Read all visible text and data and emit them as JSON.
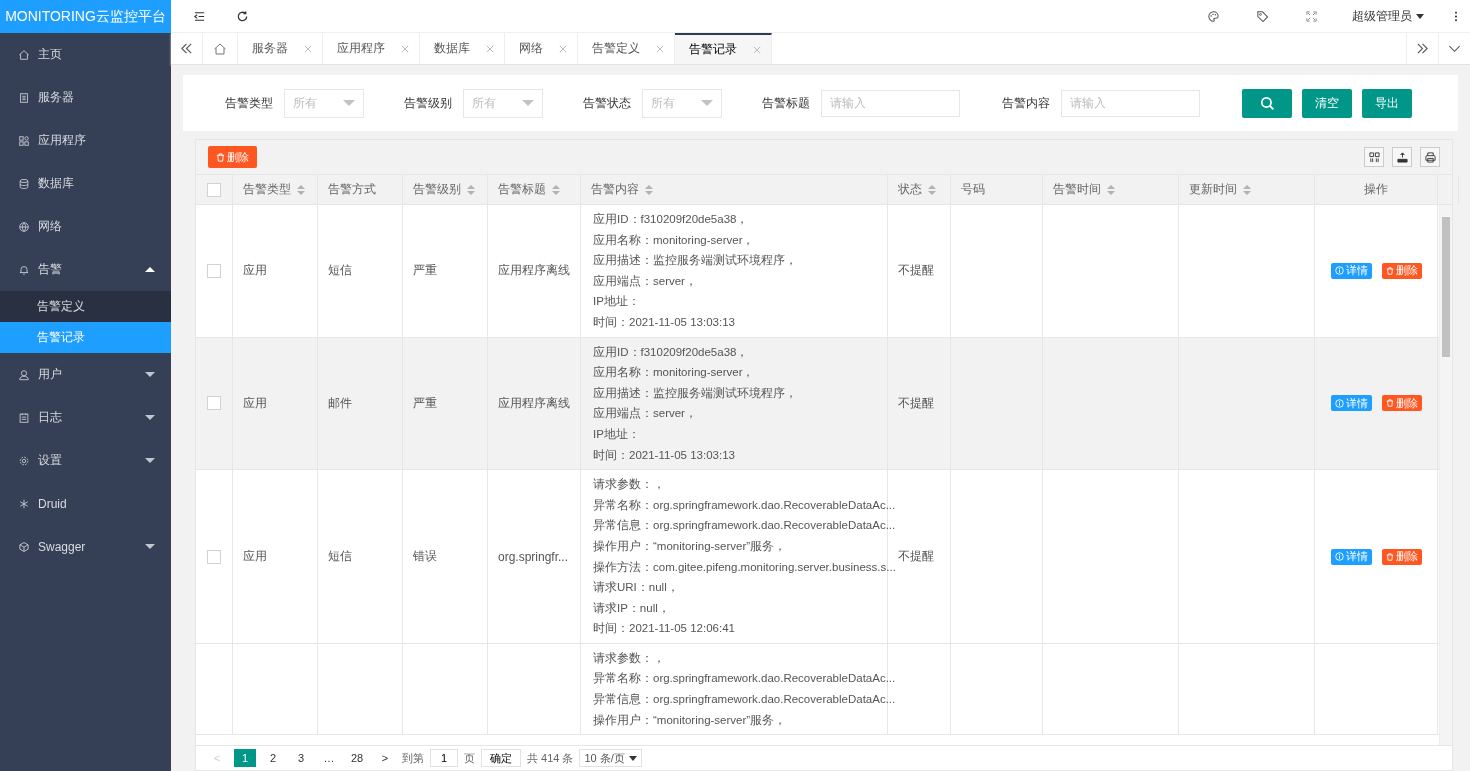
{
  "logo": "MONITORING云监控平台",
  "header": {
    "user": "超级管理员"
  },
  "sidebar": {
    "items": [
      {
        "label": "主页",
        "selected": false
      },
      {
        "label": "服务器",
        "selected": false
      },
      {
        "label": "应用程序",
        "selected": false
      },
      {
        "label": "数据库",
        "selected": false
      },
      {
        "label": "网络",
        "selected": false
      },
      {
        "label": "告警",
        "selected": false,
        "expanded": true,
        "children": [
          {
            "label": "告警定义",
            "selected": false
          },
          {
            "label": "告警记录",
            "selected": true
          }
        ]
      },
      {
        "label": "用户",
        "selected": false,
        "expanded": false
      },
      {
        "label": "日志",
        "selected": false,
        "expanded": false
      },
      {
        "label": "设置",
        "selected": false,
        "expanded": false
      },
      {
        "label": "Druid",
        "selected": false
      },
      {
        "label": "Swagger",
        "selected": false,
        "expanded": false
      }
    ]
  },
  "tabs": [
    {
      "label": "服务器",
      "selected": false
    },
    {
      "label": "应用程序",
      "selected": false
    },
    {
      "label": "数据库",
      "selected": false
    },
    {
      "label": "网络",
      "selected": false
    },
    {
      "label": "告警定义",
      "selected": false
    },
    {
      "label": "告警记录",
      "selected": true
    }
  ],
  "filters": [
    {
      "kind": "select",
      "label": "告警类型",
      "placeholder": "所有"
    },
    {
      "kind": "select",
      "label": "告警级别",
      "placeholder": "所有"
    },
    {
      "kind": "select",
      "label": "告警状态",
      "placeholder": "所有"
    },
    {
      "kind": "input",
      "label": "告警标题",
      "placeholder": "请输入"
    },
    {
      "kind": "input",
      "label": "告警内容",
      "placeholder": "请输入"
    }
  ],
  "filter_buttons": [
    "清空",
    "导出"
  ],
  "toolbar": {
    "delete": "删除"
  },
  "table": {
    "select_all_checked": false,
    "columns": [
      {
        "label": "告警类型",
        "sortable": true
      },
      {
        "label": "告警方式",
        "sortable": false
      },
      {
        "label": "告警级别",
        "sortable": true
      },
      {
        "label": "告警标题",
        "sortable": true
      },
      {
        "label": "告警内容",
        "sortable": true
      },
      {
        "label": "状态",
        "sortable": true
      },
      {
        "label": "号码",
        "sortable": false
      },
      {
        "label": "告警时间",
        "sortable": true
      },
      {
        "label": "更新时间",
        "sortable": true
      },
      {
        "label": "操作",
        "sortable": false
      }
    ],
    "rows": [
      {
        "checked": false,
        "hovered": false,
        "type": "应用",
        "method": "短信",
        "level": "严重",
        "title": "应用程序离线",
        "content": [
          "应用ID：f310209f20de5a38，",
          "应用名称：monitoring-server，",
          "应用描述：监控服务端测试环境程序，",
          "应用端点：server，",
          "IP地址：",
          "时间：2021-11-05 13:03:13"
        ],
        "status": "不提醒",
        "actions": [
          "详情",
          "删除"
        ]
      },
      {
        "checked": false,
        "hovered": true,
        "type": "应用",
        "method": "邮件",
        "level": "严重",
        "title": "应用程序离线",
        "content": [
          "应用ID：f310209f20de5a38，",
          "应用名称：monitoring-server，",
          "应用描述：监控服务端测试环境程序，",
          "应用端点：server，",
          "IP地址：",
          "时间：2021-11-05 13:03:13"
        ],
        "status": "不提醒",
        "actions": [
          "详情",
          "删除"
        ]
      },
      {
        "checked": false,
        "hovered": false,
        "type": "应用",
        "method": "短信",
        "level": "错误",
        "title": "org.springfr...",
        "content": [
          "请求参数：，",
          "异常名称：org.springframework.dao.RecoverableDataAc...",
          "异常信息：org.springframework.dao.RecoverableDataAc...",
          "操作用户：“monitoring-server”服务，",
          "操作方法：com.gitee.pifeng.monitoring.server.business.s...",
          "请求URI：null，",
          "请求IP：null，",
          "时间：2021-11-05 12:06:41"
        ],
        "status": "不提醒",
        "actions": [
          "详情",
          "删除"
        ]
      },
      {
        "hovered": false,
        "content": [
          "请求参数：，",
          "异常名称：org.springframework.dao.RecoverableDataAc...",
          "异常信息：org.springframework.dao.RecoverableDataAc...",
          "操作用户：“monitoring-server”服务，"
        ]
      }
    ]
  },
  "pagination": {
    "pages": [
      {
        "label": "1",
        "selected": true
      },
      {
        "label": "2",
        "selected": false
      },
      {
        "label": "3",
        "selected": false
      },
      {
        "label": "…",
        "selected": false
      },
      {
        "label": "28",
        "selected": false
      }
    ],
    "prev": "<",
    "next": ">",
    "goto": "到第",
    "page_value": "1",
    "page_unit": "页",
    "confirm": "确定",
    "total": "共 414 条",
    "page_size": "10 条/页"
  }
}
